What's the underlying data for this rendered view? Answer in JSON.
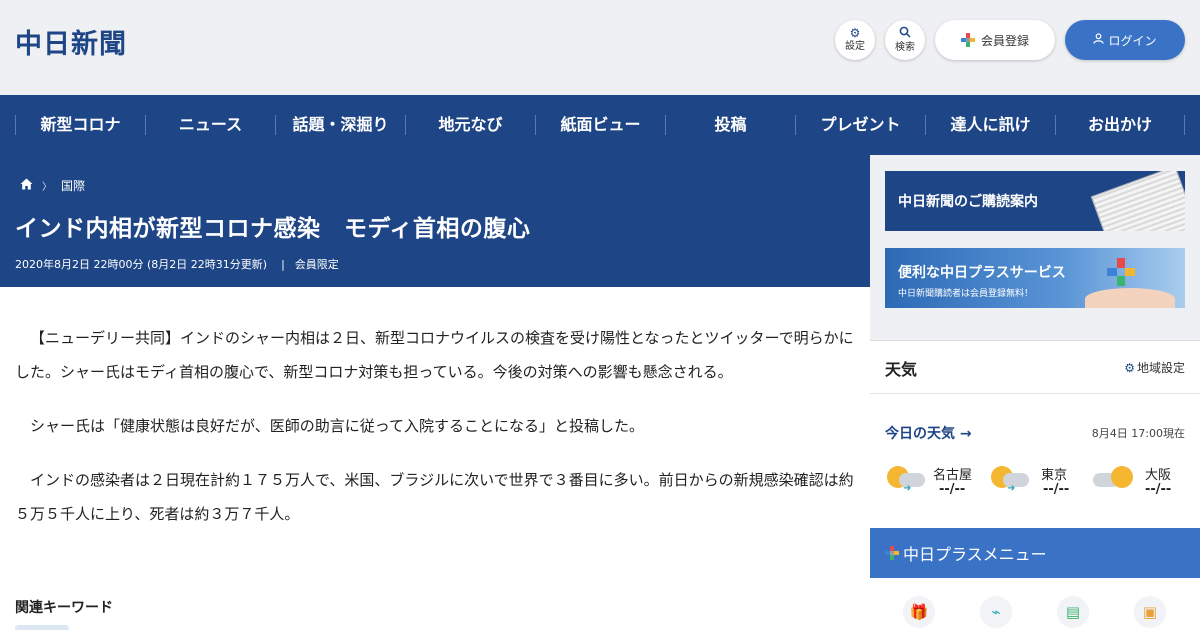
{
  "header": {
    "logo": "中日新聞",
    "settings_label": "設定",
    "search_label": "検索",
    "member_label": "会員登録",
    "login_label": "ログイン"
  },
  "nav": {
    "items": [
      "新型コロナ",
      "ニュース",
      "話題・深掘り",
      "地元なび",
      "紙面ビュー",
      "投稿",
      "プレゼント",
      "達人に訊け",
      "お出かけ"
    ]
  },
  "article": {
    "breadcrumb": [
      "国際"
    ],
    "title": "インド内相が新型コロナ感染　モディ首相の腹心",
    "date": "2020年8月2日 22時00分 (8月2日 22時31分更新)",
    "badge": "会員限定",
    "paragraphs": [
      "【ニューデリー共同】インドのシャー内相は２日、新型コロナウイルスの検査を受け陽性となったとツイッターで明らかにした。シャー氏はモディ首相の腹心で、新型コロナ対策も担っている。今後の対策への影響も懸念される。",
      "シャー氏は「健康状態は良好だが、医師の助言に従って入院することになる」と投稿した。",
      "インドの感染者は２日現在計約１７５万人で、米国、ブラジルに次いで世界で３番目に多い。前日からの新規感染確認は約５万５千人に上り、死者は約３万７千人。"
    ],
    "keywords_title": "関連キーワード"
  },
  "sidebar": {
    "banner1": "中日新聞のご購読案内",
    "banner2_title": "便利な中日プラスサービス",
    "banner2_sub": "中日新聞購読者は会員登録無料！",
    "weather": {
      "title": "天気",
      "region_setting": "地域設定",
      "today": "今日の天気",
      "as_of": "8月4日 17:00現在",
      "cities": [
        {
          "name": "名古屋",
          "temp": "--/--"
        },
        {
          "name": "東京",
          "temp": "--/--"
        },
        {
          "name": "大阪",
          "temp": "--/--"
        }
      ]
    },
    "plus_menu": "中日プラスメニュー"
  }
}
